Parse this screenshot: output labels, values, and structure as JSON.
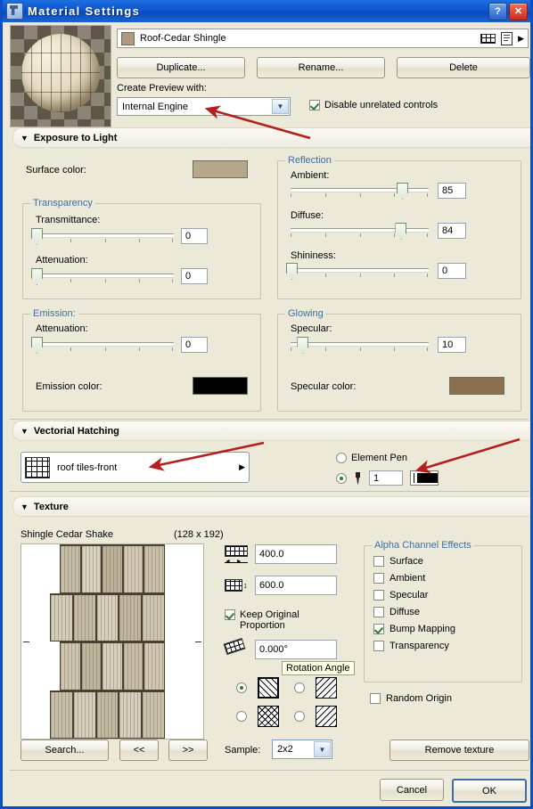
{
  "window": {
    "title": "Material Settings",
    "help_button": "?",
    "close_button": "✕"
  },
  "header": {
    "material_name": "Roof-Cedar Shingle",
    "duplicate_label": "Duplicate...",
    "rename_label": "Rename...",
    "delete_label": "Delete",
    "create_preview_label": "Create Preview with:",
    "engine_value": "Internal Engine",
    "disable_unrelated_label": "Disable unrelated controls",
    "disable_unrelated_checked": true,
    "swatch_color": "#b09a7e"
  },
  "exposure": {
    "section_title": "Exposure to Light",
    "surface_color_label": "Surface color:",
    "surface_color": "#b5a78c",
    "transparency": {
      "title": "Transparency",
      "rows": [
        {
          "label": "Transmittance:",
          "value": "0",
          "pct": 0
        },
        {
          "label": "Attenuation:",
          "value": "0",
          "pct": 0
        }
      ]
    },
    "reflection": {
      "title": "Reflection",
      "rows": [
        {
          "label": "Ambient:",
          "value": "85",
          "pct": 85
        },
        {
          "label": "Diffuse:",
          "value": "84",
          "pct": 84
        },
        {
          "label": "Shininess:",
          "value": "0",
          "pct": 0
        }
      ]
    },
    "emission": {
      "title": "Emission:",
      "rows": [
        {
          "label": "Attenuation:",
          "value": "0",
          "pct": 0
        }
      ],
      "color_label": "Emission color:",
      "color": "#000000"
    },
    "glowing": {
      "title": "Glowing",
      "rows": [
        {
          "label": "Specular:",
          "value": "10",
          "pct": 10
        }
      ],
      "color_label": "Specular color:",
      "color": "#8b6f4e"
    }
  },
  "hatching": {
    "section_title": "Vectorial Hatching",
    "pattern_name": "roof tiles-front",
    "element_pen_label": "Element Pen",
    "element_pen_selected": false,
    "custom_pen_selected": true,
    "pen_number": "1",
    "pen_color": "#000000"
  },
  "texture": {
    "section_title": "Texture",
    "texture_name": "Shingle Cedar Shake",
    "texture_size": "(128 x 192)",
    "width_value": "400.0",
    "height_value": "600.0",
    "keep_proportion_label_line1": "Keep Original",
    "keep_proportion_label_line2": "Proportion",
    "keep_proportion_checked": true,
    "rotation_value": "0.000°",
    "rotation_tooltip": "Rotation Angle",
    "mirror_options": [
      {
        "selected": true
      },
      {
        "selected": false
      },
      {
        "selected": false
      },
      {
        "selected": false
      }
    ],
    "alpha": {
      "title": "Alpha Channel Effects",
      "items": [
        {
          "label": "Surface",
          "checked": false
        },
        {
          "label": "Ambient",
          "checked": false
        },
        {
          "label": "Specular",
          "checked": false
        },
        {
          "label": "Diffuse",
          "checked": false
        },
        {
          "label": "Bump Mapping",
          "checked": true
        },
        {
          "label": "Transparency",
          "checked": false
        }
      ]
    },
    "random_origin_label": "Random Origin",
    "random_origin_checked": false,
    "search_label": "Search...",
    "prev_label": "<<",
    "next_label": ">>",
    "sample_label": "Sample:",
    "sample_value": "2x2",
    "remove_texture_label": "Remove texture"
  },
  "footer": {
    "cancel_label": "Cancel",
    "ok_label": "OK"
  }
}
